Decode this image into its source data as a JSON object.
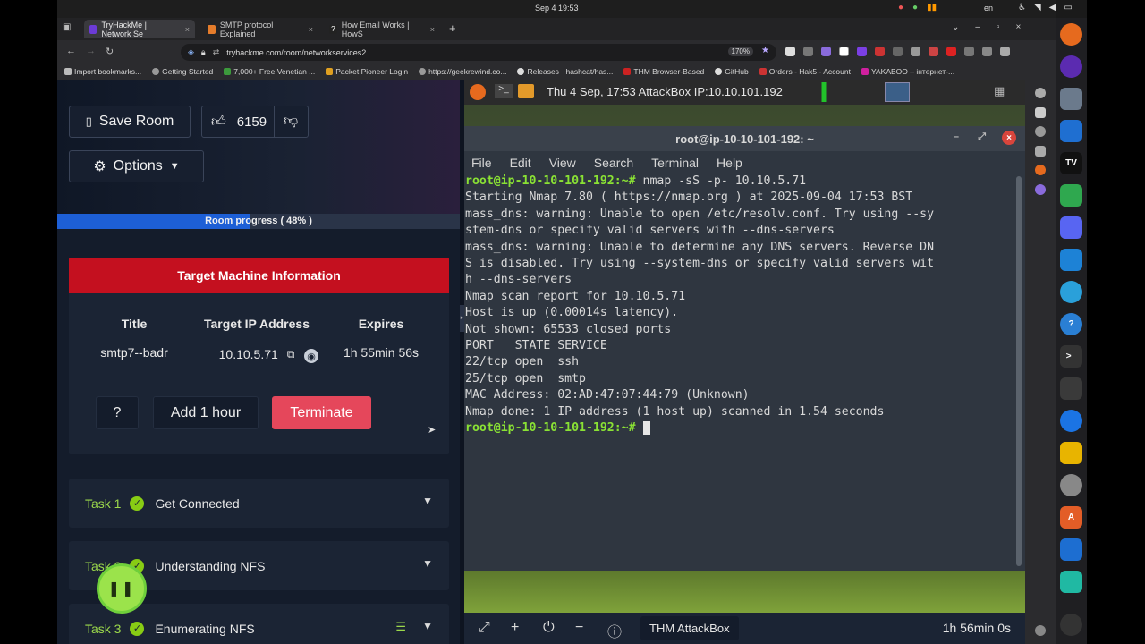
{
  "system": {
    "clock": "Sep 4  19:53",
    "lang": "en"
  },
  "browser": {
    "tabs": [
      {
        "label": "TryHackMe | Network Se",
        "active": true,
        "color": "#6c3bd6"
      },
      {
        "label": "SMTP protocol Explained",
        "active": false,
        "color": "#e57c2b"
      },
      {
        "label": "How Email Works | HowS",
        "active": false,
        "color": "#222222"
      }
    ],
    "url": "tryhackme.com/room/networkservices2",
    "zoom": "170%",
    "bookmarks": [
      "Import bookmarks...",
      "Getting Started",
      "7,000+ Free Venetian ...",
      "Packet Pioneer Login",
      "https://geekrewind.co...",
      "Releases · hashcat/has...",
      "THM Browser-Based",
      "GitHub",
      "Orders - Hak5 - Account",
      "YAKABOO – інтернет-..."
    ]
  },
  "room": {
    "save_label": "Save Room",
    "likes": "6159",
    "options_label": "Options",
    "progress_label": "Room progress ( 48% )",
    "progress_percent": 48,
    "target": {
      "heading": "Target Machine Information",
      "col_title": "Title",
      "col_ip": "Target IP Address",
      "col_expires": "Expires",
      "title_value": "smtp7--badr",
      "ip_value": "10.10.5.71",
      "expires_value": "1h 55min 56s",
      "help_label": "?",
      "add_hour_label": "Add 1 hour",
      "terminate_label": "Terminate"
    },
    "tasks": [
      {
        "num": "Task 1",
        "name": "Get Connected"
      },
      {
        "num": "Task 2",
        "name": "Understanding NFS"
      },
      {
        "num": "Task 3",
        "name": "Enumerating NFS"
      }
    ]
  },
  "attackbox": {
    "taskbar_text": "Thu 4 Sep, 17:53 AttackBox IP:10.10.101.192",
    "terminal_title": "root@ip-10-10-101-192: ~",
    "menu": [
      "File",
      "Edit",
      "View",
      "Search",
      "Terminal",
      "Help"
    ],
    "lines": [
      {
        "prompt": "root@ip-10-10-101-192:~#",
        "text": " nmap -sS -p- 10.10.5.71"
      },
      {
        "prompt": "",
        "text": "Starting Nmap 7.80 ( https://nmap.org ) at 2025-09-04 17:53 BST"
      },
      {
        "prompt": "",
        "text": "mass_dns: warning: Unable to open /etc/resolv.conf. Try using --sy"
      },
      {
        "prompt": "",
        "text": "stem-dns or specify valid servers with --dns-servers"
      },
      {
        "prompt": "",
        "text": "mass_dns: warning: Unable to determine any DNS servers. Reverse DN"
      },
      {
        "prompt": "",
        "text": "S is disabled. Try using --system-dns or specify valid servers wit"
      },
      {
        "prompt": "",
        "text": "h --dns-servers"
      },
      {
        "prompt": "",
        "text": "Nmap scan report for 10.10.5.71"
      },
      {
        "prompt": "",
        "text": "Host is up (0.00014s latency)."
      },
      {
        "prompt": "",
        "text": "Not shown: 65533 closed ports"
      },
      {
        "prompt": "",
        "text": "PORT   STATE SERVICE"
      },
      {
        "prompt": "",
        "text": "22/tcp open  ssh"
      },
      {
        "prompt": "",
        "text": "25/tcp open  smtp"
      },
      {
        "prompt": "",
        "text": "MAC Address: 02:AD:47:07:44:79 (Unknown)"
      },
      {
        "prompt": "",
        "text": ""
      },
      {
        "prompt": "",
        "text": "Nmap done: 1 IP address (1 host up) scanned in 1.54 seconds"
      },
      {
        "prompt": "root@ip-10-10-101-192:~#",
        "text": " "
      }
    ],
    "bottom_label": "THM AttackBox",
    "bottom_timer": "1h 56min 0s"
  }
}
